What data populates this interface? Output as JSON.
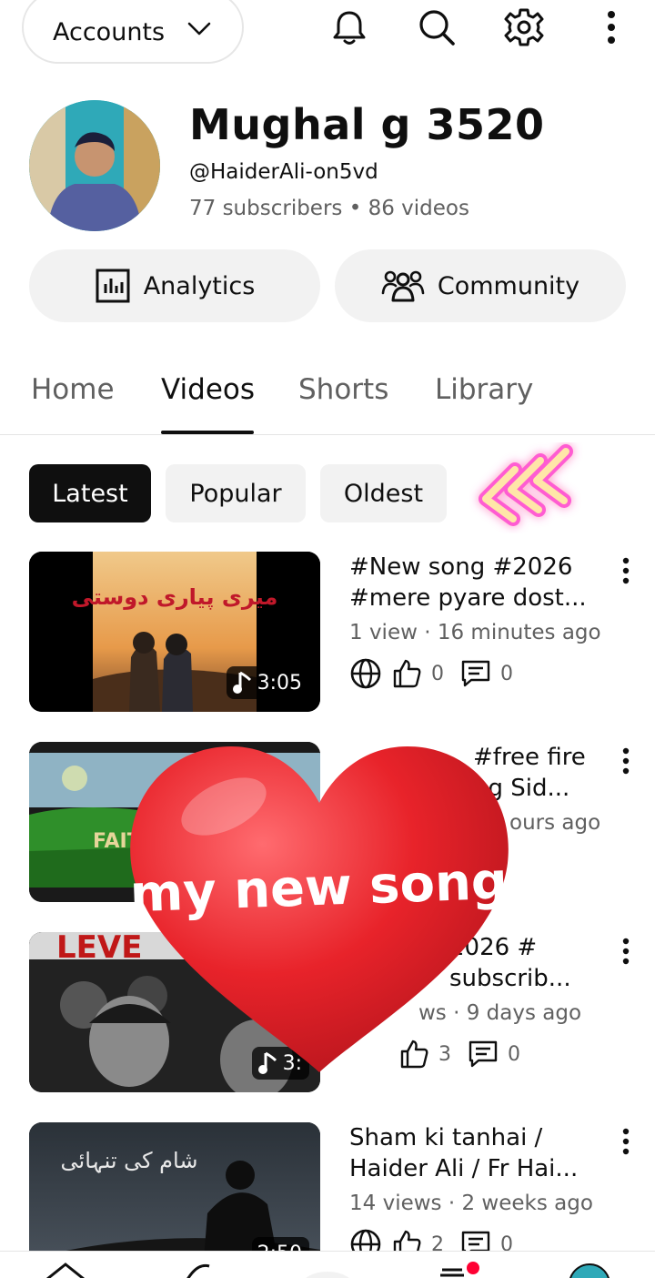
{
  "topbar": {
    "accounts_label": "Accounts",
    "icons": [
      "bell-icon",
      "search-icon",
      "gear-icon",
      "more-vertical-icon"
    ]
  },
  "profile": {
    "channel_name": "Mughal g 3520",
    "handle": "@HaiderAli-on5vd",
    "stats": "77 subscribers • 86 videos",
    "analytics_label": "Analytics",
    "community_label": "Community"
  },
  "tabs": [
    {
      "label": "Home",
      "active": false
    },
    {
      "label": "Videos",
      "active": true
    },
    {
      "label": "Shorts",
      "active": false
    },
    {
      "label": "Library",
      "active": false
    }
  ],
  "chips": [
    {
      "label": "Latest",
      "active": true
    },
    {
      "label": "Popular",
      "active": false
    },
    {
      "label": "Oldest",
      "active": false
    }
  ],
  "videos": [
    {
      "title": "#New song #2026 #mere pyare dost...",
      "meta": "1 view · 16 minutes ago",
      "duration": "3:05",
      "likes": "0",
      "comments": "0",
      "thumb_text": "میری پیاری دوستی"
    },
    {
      "title": "#free fire ng Sid...",
      "meta": "ours ago",
      "duration": "",
      "likes": "",
      "comments": "",
      "thumb_text": "FAITH"
    },
    {
      "title": "2026 # subscrib...",
      "meta": "ws · 9 days ago",
      "duration": "3:",
      "likes": "3",
      "comments": "0",
      "thumb_text": "LEVE"
    },
    {
      "title": "Sham ki tanhai / Haider Ali / Fr Hai...",
      "meta": "14 views · 2 weeks ago",
      "duration": "2:50",
      "likes": "2",
      "comments": "0",
      "thumb_text": "شام کی تنہائی"
    }
  ],
  "sticker": {
    "heart_text": "my new song"
  },
  "colors": {
    "accent": "#0f0f0f",
    "chip_bg": "#f2f2f2",
    "heart": "#e8232a",
    "notification_dot": "#ff0033"
  }
}
